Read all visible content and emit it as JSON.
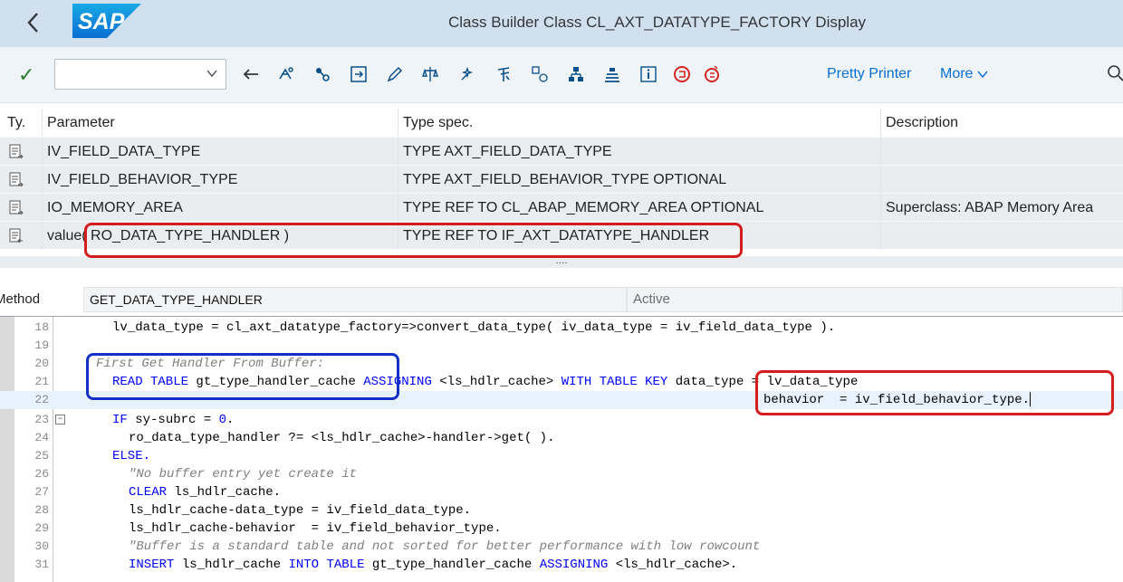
{
  "window": {
    "title": "Class Builder Class CL_AXT_DATATYPE_FACTORY Display",
    "logo_text": "SAP"
  },
  "toolbar": {
    "combo_value": "",
    "pretty_printer_label": "Pretty Printer",
    "more_label": "More",
    "icons": [
      "back-arrow-icon",
      "other-object-icon",
      "where-used-icon",
      "display-object-list-icon",
      "edit-pencil-icon",
      "check-icon",
      "activate-icon",
      "test-icon",
      "navigate-icon",
      "hierarchy-icon",
      "outline-icon",
      "info-icon",
      "ecc-icon",
      "ecc2-icon"
    ]
  },
  "params": {
    "headers": {
      "ty": "Ty.",
      "parameter": "Parameter",
      "type": "Type spec.",
      "desc": "Description"
    },
    "rows": [
      {
        "parameter": "IV_FIELD_DATA_TYPE",
        "type": "TYPE AXT_FIELD_DATA_TYPE",
        "desc": ""
      },
      {
        "parameter": "IV_FIELD_BEHAVIOR_TYPE",
        "type": "TYPE AXT_FIELD_BEHAVIOR_TYPE OPTIONAL",
        "desc": ""
      },
      {
        "parameter": "IO_MEMORY_AREA",
        "type": "TYPE REF TO CL_ABAP_MEMORY_AREA OPTIONAL",
        "desc": "Superclass: ABAP Memory Area"
      },
      {
        "parameter": "value( RO_DATA_TYPE_HANDLER )",
        "type": "TYPE REF TO IF_AXT_DATATYPE_HANDLER",
        "desc": ""
      }
    ],
    "splitter_dots": "...."
  },
  "method": {
    "label": "Method",
    "name": "GET_DATA_TYPE_HANDLER",
    "status": "Active"
  },
  "code": {
    "lines": [
      {
        "n": "18",
        "text": "  lv_data_type = cl_axt_datatype_factory=>convert_data_type( iv_data_type = iv_field_data_type )."
      },
      {
        "n": "19",
        "text": ""
      },
      {
        "n": "20",
        "text": "* First Get Handler From Buffer:"
      },
      {
        "n": "21",
        "text": "  READ TABLE gt_type_handler_cache ASSIGNING <ls_hdlr_cache> WITH TABLE KEY data_type = lv_data_type"
      },
      {
        "n": "22",
        "text": "                                                                          behavior  = iv_field_behavior_type."
      },
      {
        "n": "23",
        "text": "  IF sy-subrc = 0."
      },
      {
        "n": "24",
        "text": "    ro_data_type_handler ?= <ls_hdlr_cache>-handler->get( )."
      },
      {
        "n": "25",
        "text": "  ELSE."
      },
      {
        "n": "26",
        "text": "    \"No buffer entry yet create it"
      },
      {
        "n": "27",
        "text": "    CLEAR ls_hdlr_cache."
      },
      {
        "n": "28",
        "text": "    ls_hdlr_cache-data_type = iv_field_data_type."
      },
      {
        "n": "29",
        "text": "    ls_hdlr_cache-behavior  = iv_field_behavior_type."
      },
      {
        "n": "30",
        "text": "    \"Buffer is a standard table and not sorted for better performance with low rowcount"
      },
      {
        "n": "31",
        "text": "    INSERT ls_hdlr_cache INTO TABLE gt_type_handler_cache ASSIGNING <ls_hdlr_cache>."
      }
    ]
  },
  "colors": {
    "annotation_red": "#d61d1d",
    "annotation_blue": "#1430c9",
    "keyword_blue": "#0000ff",
    "link_blue": "#0a6ed1"
  }
}
